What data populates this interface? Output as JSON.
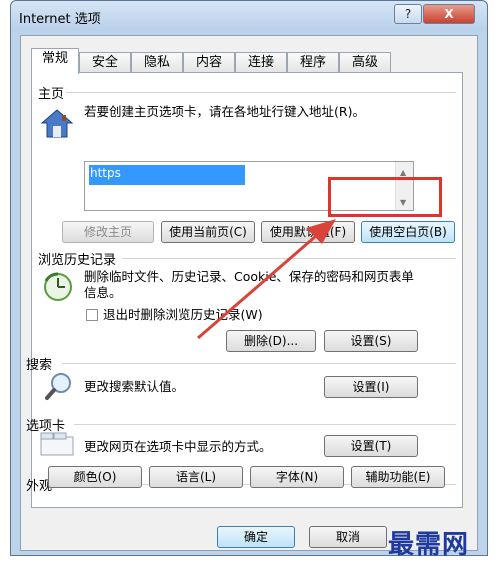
{
  "window": {
    "title": "Internet 选项",
    "help_label": "?",
    "close_label": "X"
  },
  "tabs": [
    "常规",
    "安全",
    "隐私",
    "内容",
    "连接",
    "程序",
    "高级"
  ],
  "home": {
    "heading": "主页",
    "description": "若要创建主页选项卡，请在各地址行键入地址(R)。",
    "address_value": "https",
    "buttons": {
      "modify": "修改主页",
      "use_current": "使用当前页(C)",
      "use_default": "使用默认值(F)",
      "use_blank": "使用空白页(B)"
    }
  },
  "history": {
    "heading": "浏览历史记录",
    "description": "删除临时文件、历史记录、Cookie、保存的密码和网页表单信息。",
    "checkbox_label": "退出时删除浏览历史记录(W)",
    "delete_label": "删除(D)...",
    "settings_label": "设置(S)"
  },
  "search": {
    "heading": "搜索",
    "description": "更改搜索默认值。",
    "settings_label": "设置(I)"
  },
  "tabs_section": {
    "heading": "选项卡",
    "description": "更改网页在选项卡中显示的方式。",
    "settings_label": "设置(T)"
  },
  "appearance": {
    "heading": "外观",
    "colors": "颜色(O)",
    "languages": "语言(L)",
    "fonts": "字体(N)",
    "accessibility": "辅助功能(E)"
  },
  "footer": {
    "ok": "确定",
    "cancel": "取消"
  },
  "watermark": "最需网",
  "colors": {
    "highlight": "#e0332e",
    "arrow": "#d9443a",
    "selection": "#3399ff"
  }
}
